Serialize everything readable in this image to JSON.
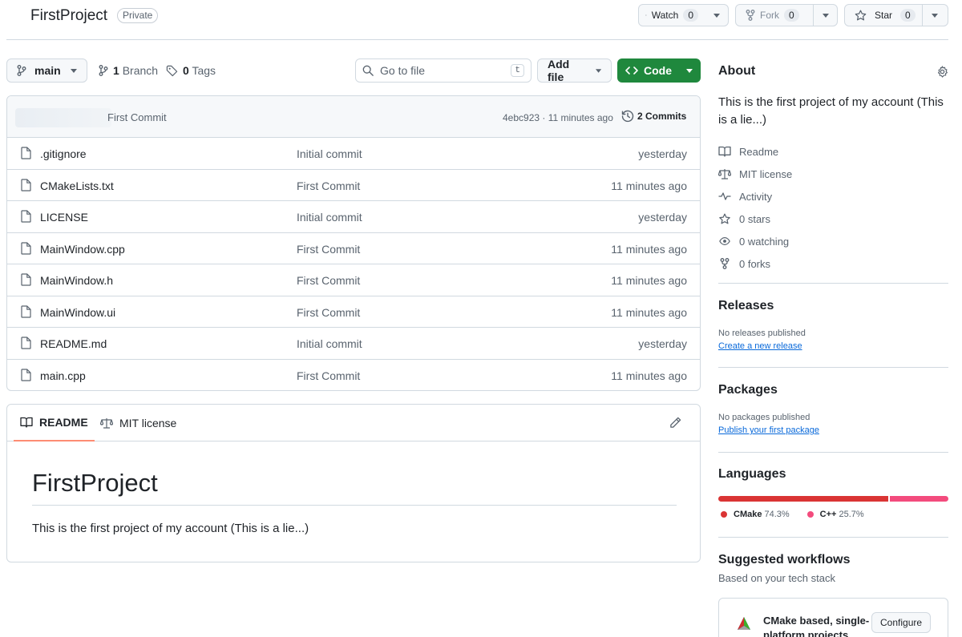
{
  "header": {
    "repo_name": "FirstProject",
    "visibility": "Private",
    "watch": {
      "label": "Watch",
      "count": "0"
    },
    "fork": {
      "label": "Fork",
      "count": "0"
    },
    "star": {
      "label": "Star",
      "count": "0"
    }
  },
  "toolbar": {
    "branch": "main",
    "branches_count": "1",
    "branches_label": "Branch",
    "tags_count": "0",
    "tags_label": "Tags",
    "search_placeholder": "Go to file",
    "search_shortcut": "t",
    "add_file_label": "Add file",
    "code_label": "Code"
  },
  "latest_commit": {
    "message": "First Commit",
    "meta": "4ebc923 · 11 minutes ago",
    "commits_label": "2 Commits"
  },
  "files": [
    {
      "name": ".gitignore",
      "message": "Initial commit",
      "time": "yesterday"
    },
    {
      "name": "CMakeLists.txt",
      "message": "First Commit",
      "time": "11 minutes ago"
    },
    {
      "name": "LICENSE",
      "message": "Initial commit",
      "time": "yesterday"
    },
    {
      "name": "MainWindow.cpp",
      "message": "First Commit",
      "time": "11 minutes ago"
    },
    {
      "name": "MainWindow.h",
      "message": "First Commit",
      "time": "11 minutes ago"
    },
    {
      "name": "MainWindow.ui",
      "message": "First Commit",
      "time": "11 minutes ago"
    },
    {
      "name": "README.md",
      "message": "Initial commit",
      "time": "yesterday"
    },
    {
      "name": "main.cpp",
      "message": "First Commit",
      "time": "11 minutes ago"
    }
  ],
  "readme": {
    "tab_readme": "README",
    "tab_license": "MIT license",
    "heading": "FirstProject",
    "body": "This is the first project of my account (This is a lie...)"
  },
  "about": {
    "title": "About",
    "description": "This is the first project of my account (This is a lie...)",
    "readme": "Readme",
    "license": "MIT license",
    "activity": "Activity",
    "stars": "0 stars",
    "watching": "0 watching",
    "forks": "0 forks"
  },
  "releases": {
    "title": "Releases",
    "empty": "No releases published",
    "link": "Create a new release"
  },
  "packages": {
    "title": "Packages",
    "empty": "No packages published",
    "link": "Publish your first package"
  },
  "languages": {
    "title": "Languages",
    "items": [
      {
        "name": "CMake",
        "percent_label": "74.3%",
        "percent": 74.3,
        "color": "#da3434"
      },
      {
        "name": "C++",
        "percent_label": "25.7%",
        "percent": 25.7,
        "color": "#f34b7d"
      }
    ]
  },
  "workflows": {
    "title": "Suggested workflows",
    "subtitle": "Based on your tech stack",
    "card_title": "CMake based, single-platform projects",
    "configure_label": "Configure"
  }
}
